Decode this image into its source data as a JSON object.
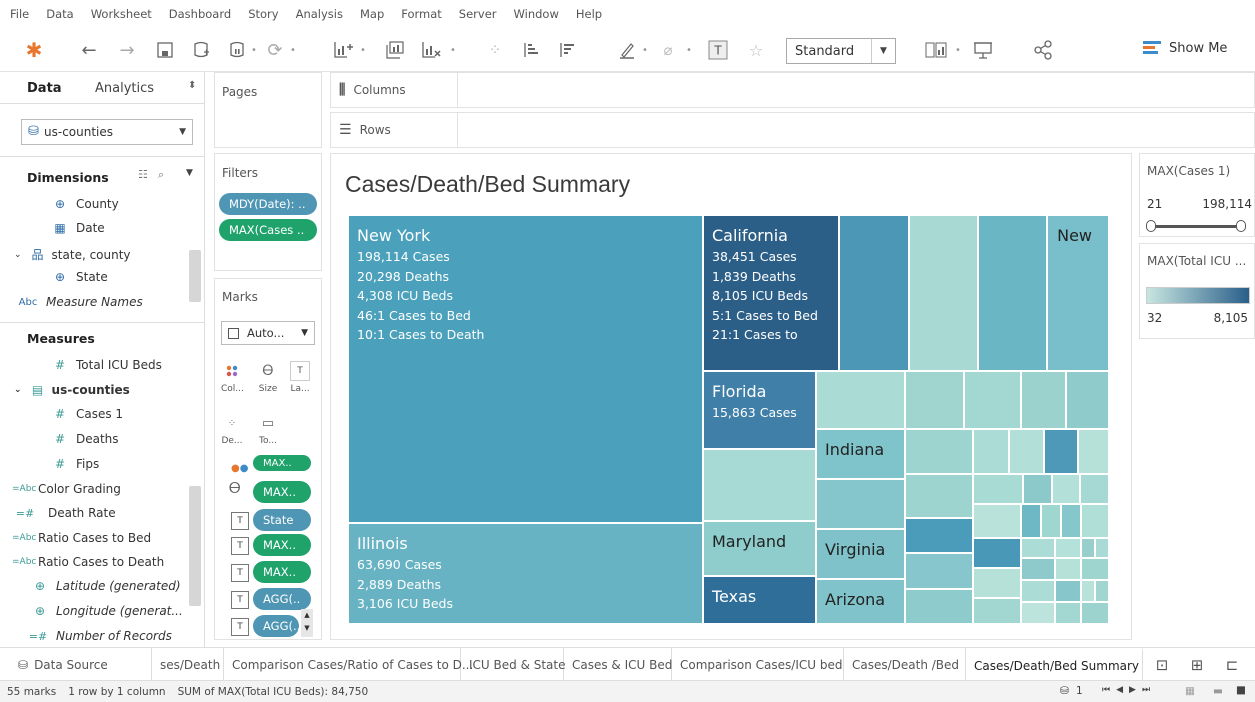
{
  "menu": [
    "File",
    "Data",
    "Worksheet",
    "Dashboard",
    "Story",
    "Analysis",
    "Map",
    "Format",
    "Server",
    "Window",
    "Help"
  ],
  "toolbar": {
    "fit_select": "Standard",
    "show_me_label": "Show Me"
  },
  "data_pane": {
    "tab_data": "Data",
    "tab_analytics": "Analytics",
    "datasource": "us-counties",
    "dimensions_title": "Dimensions",
    "dimensions": [
      {
        "label": "County",
        "icon": "globe-icon"
      },
      {
        "label": "Date",
        "icon": "calendar-icon"
      },
      {
        "label": "state, county",
        "icon": "hierarchy-icon"
      },
      {
        "label": "State",
        "icon": "globe-icon"
      },
      {
        "label": "Measure Names",
        "icon": "abc-icon"
      }
    ],
    "measures_title": "Measures",
    "measures": [
      {
        "label": "Total ICU Beds",
        "icon": "hash-icon"
      },
      {
        "label": "us-counties",
        "icon": "table-icon"
      },
      {
        "label": "Cases 1",
        "icon": "hash-icon"
      },
      {
        "label": "Deaths",
        "icon": "hash-icon"
      },
      {
        "label": "Fips",
        "icon": "hash-icon"
      },
      {
        "label": "Color Grading",
        "icon": "calc-abc-icon"
      },
      {
        "label": "Death Rate",
        "icon": "calc-hash-icon"
      },
      {
        "label": "Ratio Cases to Bed",
        "icon": "calc-abc-icon"
      },
      {
        "label": "Ratio Cases to Death",
        "icon": "calc-abc-icon"
      },
      {
        "label": "Latitude (generated)",
        "icon": "globe-icon"
      },
      {
        "label": "Longitude (generat...",
        "icon": "globe-icon"
      },
      {
        "label": "Number of Records",
        "icon": "calc-hash-icon"
      }
    ]
  },
  "pages_title": "Pages",
  "filters": {
    "title": "Filters",
    "pills": [
      "MDY(Date): ..",
      "MAX(Cases .."
    ]
  },
  "marks": {
    "title": "Marks",
    "mark_type": "Auto...",
    "cards": [
      "Col...",
      "Size",
      "La...",
      "De...",
      "To..."
    ],
    "pills": [
      "MAX..",
      "MAX..",
      "State",
      "MAX..",
      "MAX..",
      "AGG(..",
      "AGG(.."
    ]
  },
  "shelves": {
    "columns": "Columns",
    "rows": "Rows"
  },
  "viz": {
    "title": "Cases/Death/Bed Summary",
    "labels": {
      "new_york": [
        "New York",
        "198,114 Cases",
        "20,298 Deaths",
        "4,308 ICU Beds",
        "46:1 Cases to Bed",
        "10:1 Cases to Death"
      ],
      "california": [
        "California",
        "38,451 Cases",
        "1,839 Deaths",
        "8,105 ICU Beds",
        "5:1 Cases to Bed",
        "21:1 Cases to"
      ],
      "illinois": [
        "Illinois",
        "63,690 Cases",
        "2,889 Deaths",
        "3,106 ICU Beds"
      ],
      "florida": [
        "Florida",
        "15,863 Cases"
      ],
      "new": [
        "New"
      ],
      "indiana": [
        "Indiana"
      ],
      "maryland": [
        "Maryland"
      ],
      "virginia": [
        "Virginia"
      ],
      "texas": [
        "Texas"
      ],
      "arizona": [
        "Arizona"
      ]
    }
  },
  "chart_data": {
    "type": "treemap",
    "title": "Cases/Death/Bed Summary",
    "size_measure": "MAX(Cases 1)",
    "color_measure": "MAX(Total ICU Beds)",
    "states": [
      {
        "state": "New York",
        "cases": 198114,
        "deaths": 20298,
        "icu_beds": 4308,
        "ratio_cases_to_bed": "46:1",
        "ratio_cases_to_death": "10:1"
      },
      {
        "state": "California",
        "cases": 38451,
        "deaths": 1839,
        "icu_beds": 8105,
        "ratio_cases_to_bed": "5:1",
        "ratio_cases_to_death": "21:1"
      },
      {
        "state": "Illinois",
        "cases": 63690,
        "deaths": 2889,
        "icu_beds": 3106
      },
      {
        "state": "Florida",
        "cases": 15863
      }
    ],
    "legend_cases": {
      "min": "21",
      "max": "198,114"
    },
    "legend_icu": {
      "min": "32",
      "max": "8,105",
      "color_low": "#c7e6e0",
      "color_high": "#2a5f8a"
    }
  },
  "legend1": {
    "title": "MAX(Cases 1)",
    "min": "21",
    "max": "198,114"
  },
  "legend2": {
    "title": "MAX(Total ICU ...",
    "min": "32",
    "max": "8,105"
  },
  "sheet_tabs": [
    "Data Source",
    "ses/Death",
    "Comparison Cases/Ratio of Cases to D...",
    "ICU Bed & State",
    "Cases & ICU Bed",
    "Comparison Cases/ICU bed",
    "Cases/Death /Bed",
    "Cases/Death/Bed Summary"
  ],
  "status": {
    "marks": "55 marks",
    "layout": "1 row by 1 column",
    "sum": "SUM of MAX(Total ICU Beds): 84,750",
    "page": "1"
  }
}
